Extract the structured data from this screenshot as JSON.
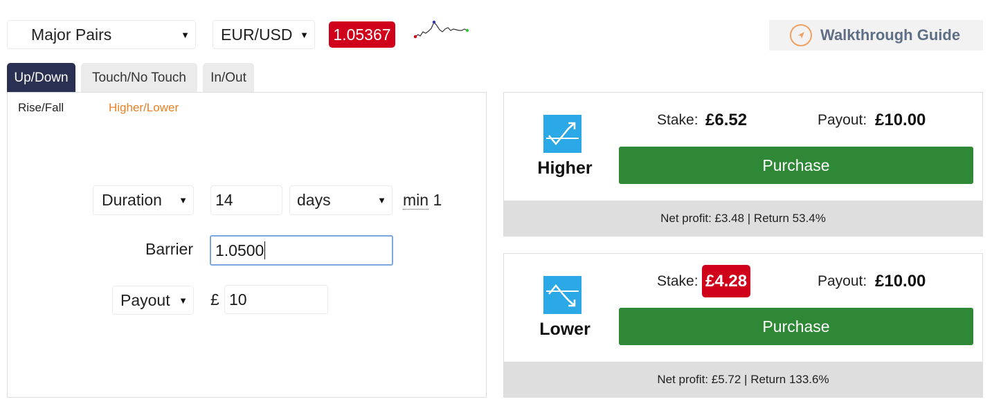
{
  "header": {
    "market_select": {
      "value": "Major Pairs"
    },
    "symbol_select": {
      "value": "EUR/USD"
    },
    "spot_price": "1.05367",
    "walkthrough_label": "Walkthrough Guide"
  },
  "tabs": [
    {
      "label": "Up/Down",
      "active": true
    },
    {
      "label": "Touch/No Touch",
      "active": false
    },
    {
      "label": "In/Out",
      "active": false
    }
  ],
  "subtabs": [
    {
      "label": "Rise/Fall",
      "active": false
    },
    {
      "label": "Higher/Lower",
      "active": true
    }
  ],
  "form": {
    "duration_select": "Duration",
    "duration_value": "14",
    "duration_unit": "days",
    "min_abbr": "min",
    "min_value": "1",
    "barrier_label": "Barrier",
    "barrier_value": "1.0500",
    "payout_select": "Payout",
    "currency_symbol": "£",
    "payout_value": "10"
  },
  "contracts": [
    {
      "type": "Higher",
      "stake_label": "Stake:",
      "stake": "£6.52",
      "payout_label": "Payout:",
      "payout": "£10.00",
      "purchase_label": "Purchase",
      "summary": "Net profit: £3.48 | Return 53.4%"
    },
    {
      "type": "Lower",
      "stake_label": "Stake:",
      "stake": "£4.28",
      "stake_highlight": true,
      "payout_label": "Payout:",
      "payout": "£10.00",
      "purchase_label": "Purchase",
      "summary": "Net profit: £5.72 | Return 133.6%"
    }
  ],
  "colors": {
    "accent_red": "#d0021b",
    "purchase_green": "#2e8836",
    "tab_active": "#2a3052",
    "subtab_active": "#e98024",
    "icon_blue": "#2aa9e6"
  },
  "icons": {
    "walkthrough": "compass-arrow-icon",
    "higher": "trend-up-icon",
    "lower": "trend-down-icon"
  }
}
